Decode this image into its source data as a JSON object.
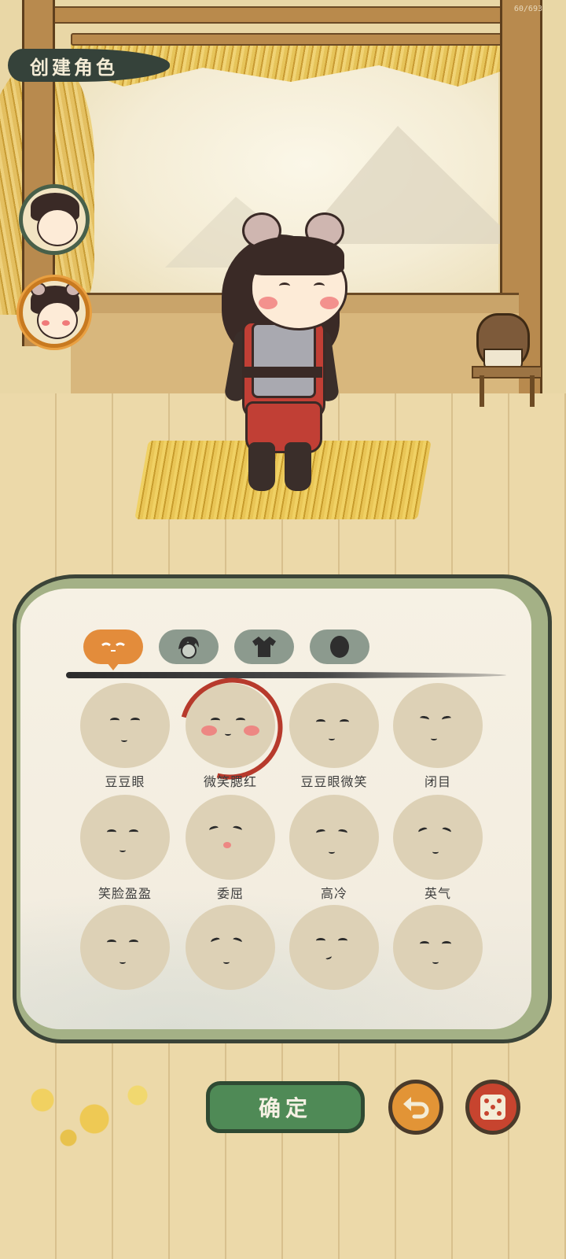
{
  "app": {
    "fps_readout": "60/693"
  },
  "title": "创建角色",
  "portraits": [
    {
      "name": "male-character-portrait",
      "selected": false
    },
    {
      "name": "female-character-portrait",
      "selected": true
    }
  ],
  "tabs": [
    {
      "icon": "face-expression-icon",
      "active": true
    },
    {
      "icon": "hairstyle-icon",
      "active": false
    },
    {
      "icon": "clothing-icon",
      "active": false
    },
    {
      "icon": "head-shape-icon",
      "active": false
    }
  ],
  "expressions": [
    {
      "label": "豆豆眼",
      "selected": false
    },
    {
      "label": "微笑腮红",
      "selected": true
    },
    {
      "label": "豆豆眼微笑",
      "selected": false
    },
    {
      "label": "闭目",
      "selected": false
    },
    {
      "label": "笑脸盈盈",
      "selected": false
    },
    {
      "label": "委屈",
      "selected": false
    },
    {
      "label": "高冷",
      "selected": false
    },
    {
      "label": "英气",
      "selected": false
    },
    {
      "label": "",
      "selected": false
    },
    {
      "label": "",
      "selected": false
    },
    {
      "label": "",
      "selected": false
    },
    {
      "label": "",
      "selected": false
    }
  ],
  "buttons": {
    "confirm": "确定",
    "undo_icon": "undo-arrow-icon",
    "random_icon": "dice-icon"
  },
  "colors": {
    "active_tab": "#e38c3b",
    "inactive_tab": "#8c9a8e",
    "confirm": "#4f8a56",
    "selected_ring": "#b73a2c"
  }
}
